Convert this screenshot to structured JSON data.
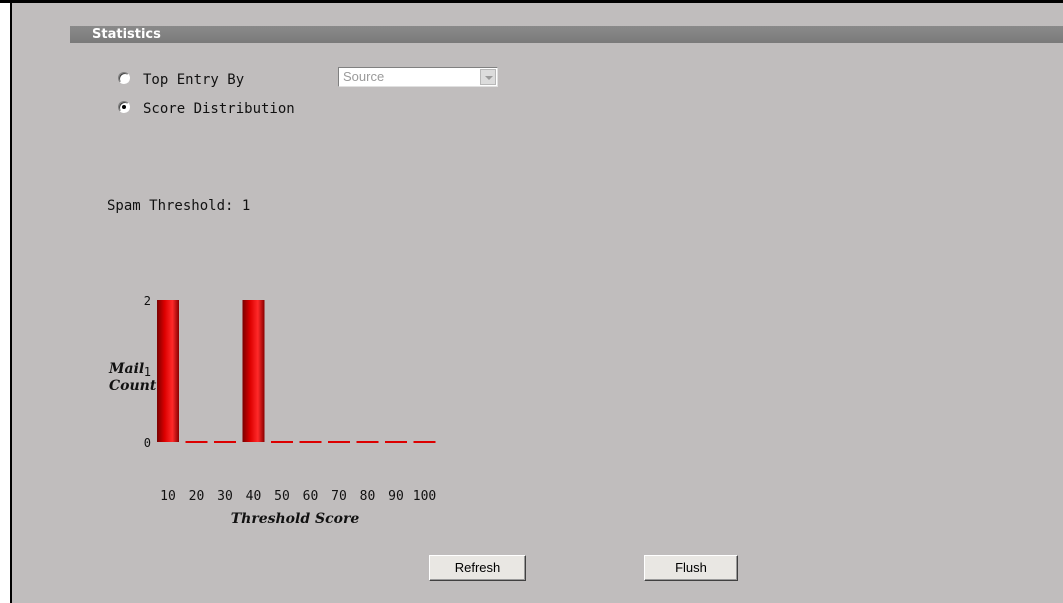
{
  "section": {
    "title": "Statistics"
  },
  "view_options": {
    "top_entry_label": "Top Entry By",
    "top_entry_selected": false,
    "score_distribution_label": "Score Distribution",
    "score_distribution_selected": true,
    "dropdown_value": "Source"
  },
  "spam_threshold_label": "Spam Threshold: 1",
  "chart_data": {
    "type": "bar",
    "xlabel": "Threshold Score",
    "ylabel": "Mail Count",
    "ylabel_lines": [
      "Mail",
      "Count"
    ],
    "categories": [
      "10",
      "20",
      "30",
      "40",
      "50",
      "60",
      "70",
      "80",
      "90",
      "100"
    ],
    "values": [
      2,
      0,
      0,
      2,
      0,
      0,
      0,
      0,
      0,
      0
    ],
    "yticks": [
      "0",
      "1",
      "2"
    ],
    "ylim": [
      0,
      2
    ],
    "bar_color": "#dd0000"
  },
  "buttons": {
    "refresh": "Refresh",
    "flush": "Flush"
  }
}
